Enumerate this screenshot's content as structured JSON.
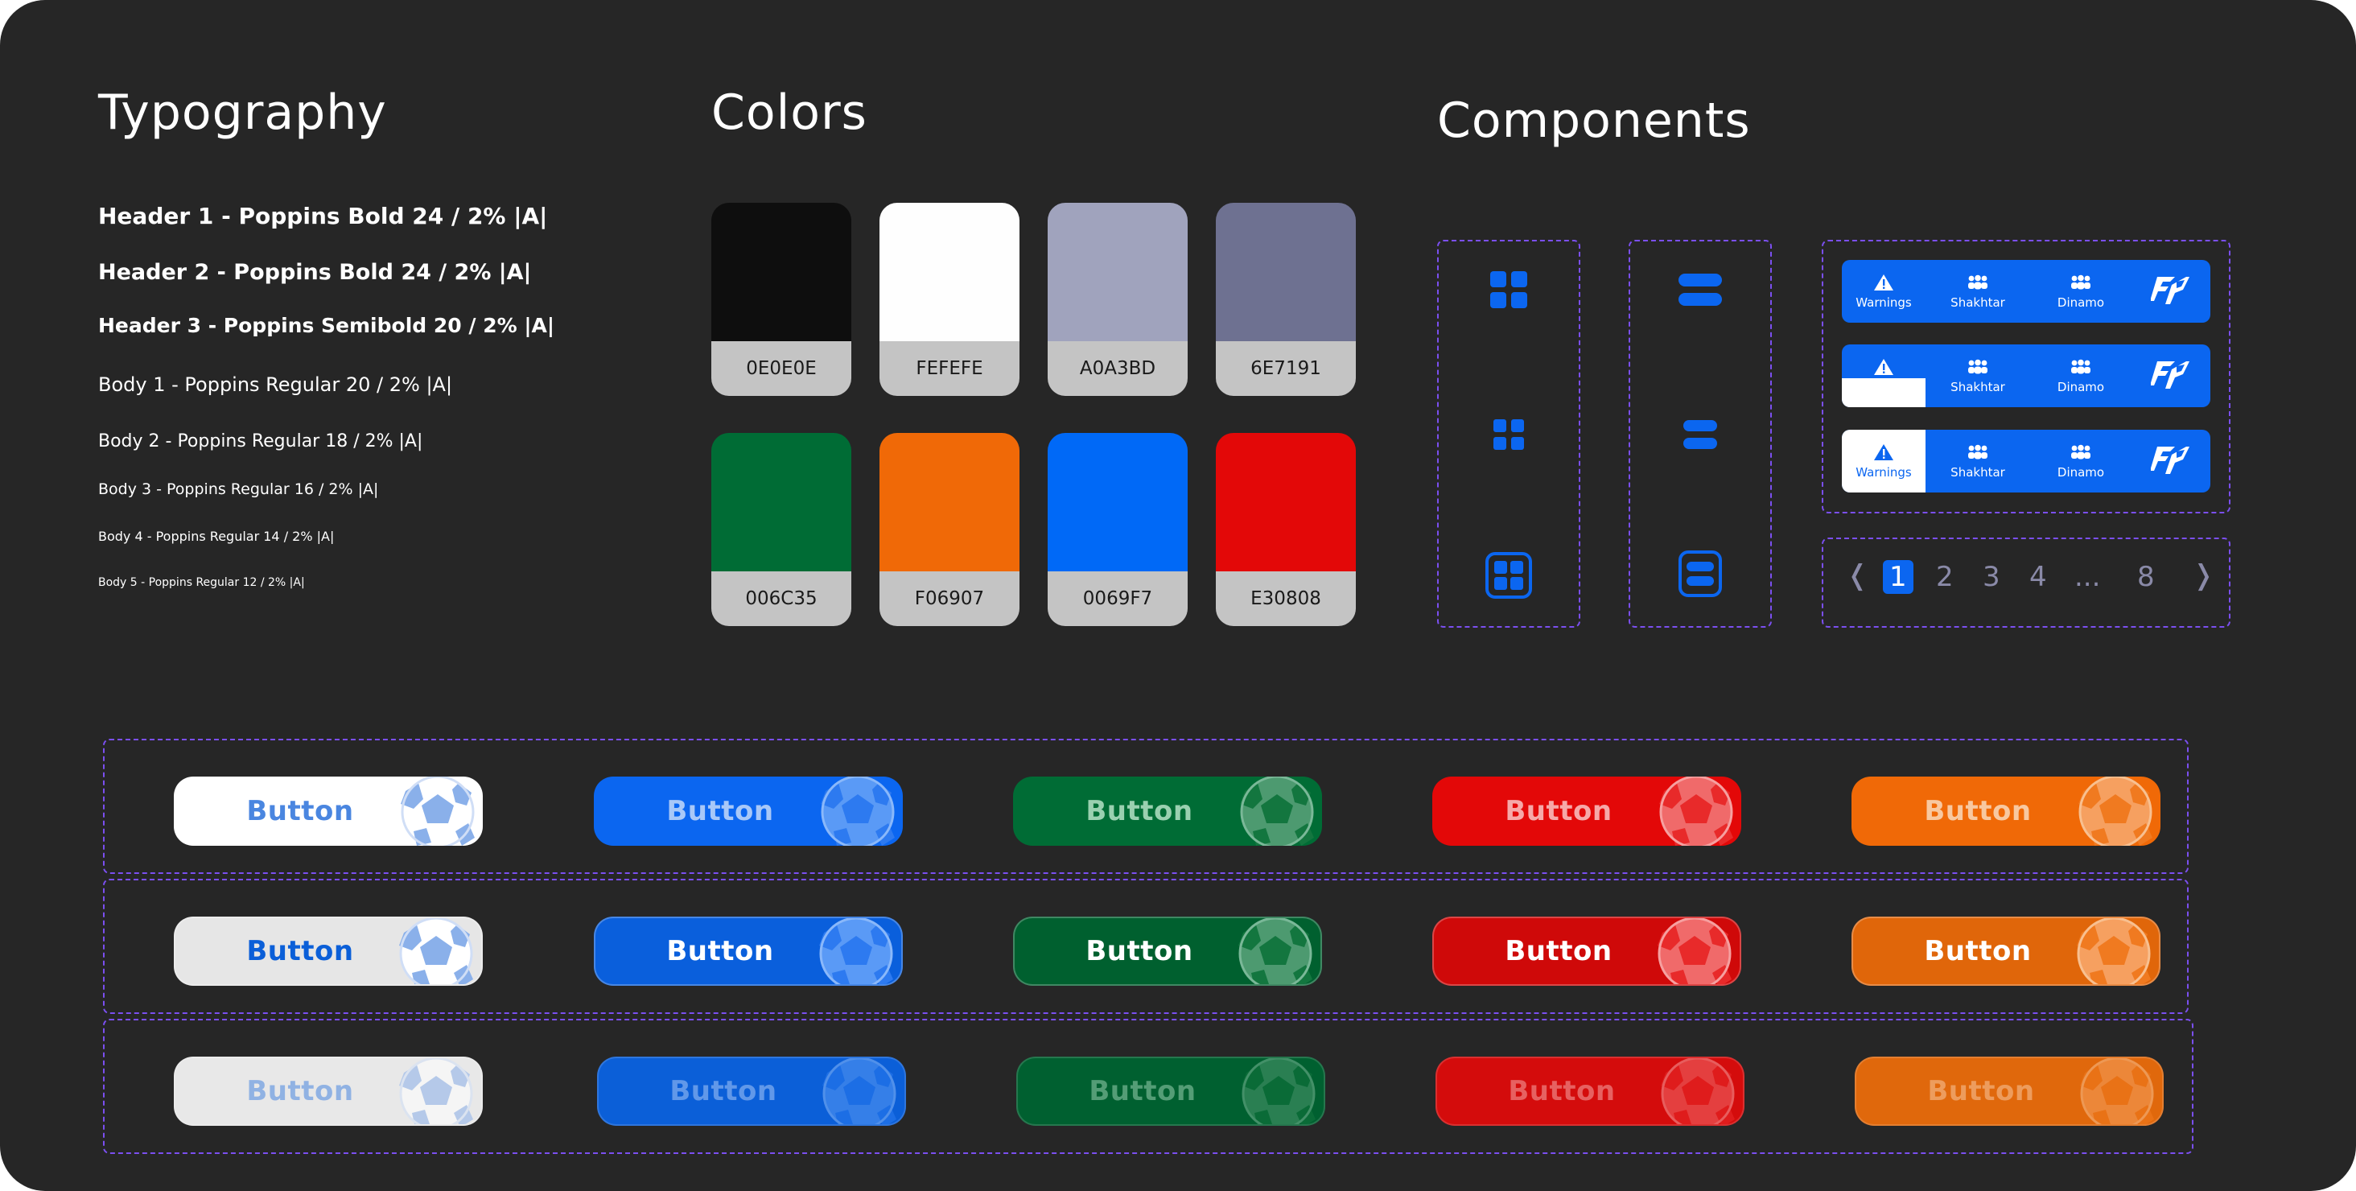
{
  "sections": {
    "typography": "Typography",
    "colors": "Colors",
    "components": "Components"
  },
  "typography": [
    {
      "text": "Header 1 - Poppins Bold 24 / 2% |A|",
      "size": 28,
      "weight": 700
    },
    {
      "text": "Header 2 - Poppins Bold 24 / 2% |A|",
      "size": 27,
      "weight": 700
    },
    {
      "text": "Header 3 - Poppins Semibold 20 / 2% |A|",
      "size": 25,
      "weight": 600
    },
    {
      "text": "Body 1 - Poppins Regular 20 / 2% |A|",
      "size": 24,
      "weight": 400
    },
    {
      "text": "Body 2 - Poppins Regular 18 / 2% |A|",
      "size": 22,
      "weight": 400
    },
    {
      "text": "Body 3 - Poppins Regular 16 / 2% |A|",
      "size": 19,
      "weight": 400
    },
    {
      "text": "Body 4 - Poppins Regular 14 / 2% |A|",
      "size": 16,
      "weight": 400
    },
    {
      "text": "Body 5 - Poppins Regular 12 / 2% |A|",
      "size": 14,
      "weight": 400
    }
  ],
  "colors": [
    {
      "hex": "#0E0E0E",
      "label": "0E0E0E"
    },
    {
      "hex": "#FEFEFE",
      "label": "FEFEFE"
    },
    {
      "hex": "#A0A3BD",
      "label": "A0A3BD"
    },
    {
      "hex": "#6E7191",
      "label": "6E7191"
    },
    {
      "hex": "#006C35",
      "label": "006C35"
    },
    {
      "hex": "#F06907",
      "label": "F06907"
    },
    {
      "hex": "#0069F7",
      "label": "0069F7"
    },
    {
      "hex": "#E30808",
      "label": "E30808"
    }
  ],
  "components": {
    "grid_icons": [
      "grid-icon",
      "grid-icon-small",
      "grid-icon-active"
    ],
    "list_icons": [
      "list-icon",
      "list-icon-small",
      "list-icon-active"
    ],
    "tabbars": [
      {
        "state": "default",
        "tabs": [
          {
            "icon": "warning-icon",
            "label": "Warnings"
          },
          {
            "icon": "team-icon",
            "label": "Shakhtar"
          },
          {
            "icon": "team-icon",
            "label": "Dinamo"
          }
        ]
      },
      {
        "state": "hover",
        "tabs": [
          {
            "icon": "warning-icon",
            "label": ""
          },
          {
            "icon": "team-icon",
            "label": "Shakhtar"
          },
          {
            "icon": "team-icon",
            "label": "Dinamo"
          }
        ]
      },
      {
        "state": "selected",
        "tabs": [
          {
            "icon": "warning-icon",
            "label": "Warnings"
          },
          {
            "icon": "team-icon",
            "label": "Shakhtar"
          },
          {
            "icon": "team-icon",
            "label": "Dinamo"
          }
        ]
      }
    ],
    "logo_icon": "fp-logo-icon",
    "pagination": {
      "prev": "❬",
      "pages": [
        "1",
        "2",
        "3",
        "4",
        "...",
        "8"
      ],
      "active": "1",
      "next": "❭"
    }
  },
  "buttons": {
    "label": "Button",
    "variants": [
      {
        "name": "white",
        "bg": "#ffffff",
        "text": "#4a86e0"
      },
      {
        "name": "blue",
        "bg": "#0b66f0",
        "text": "#a8c8f8"
      },
      {
        "name": "green",
        "bg": "#006c35",
        "text": "#9ad0b0"
      },
      {
        "name": "red",
        "bg": "#e30808",
        "text": "#f6a8a8"
      },
      {
        "name": "orange",
        "bg": "#f06907",
        "text": "#f8c8a0"
      }
    ],
    "rows": [
      "default",
      "hover",
      "disabled"
    ]
  }
}
